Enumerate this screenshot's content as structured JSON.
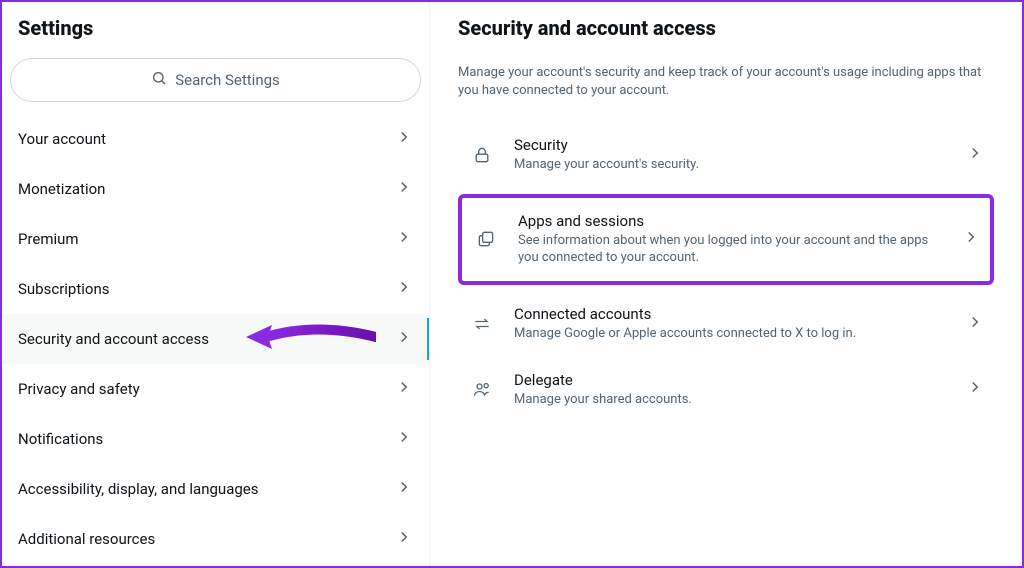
{
  "sidebar": {
    "title": "Settings",
    "search_placeholder": "Search Settings",
    "items": [
      {
        "label": "Your account"
      },
      {
        "label": "Monetization"
      },
      {
        "label": "Premium"
      },
      {
        "label": "Subscriptions"
      },
      {
        "label": "Security and account access"
      },
      {
        "label": "Privacy and safety"
      },
      {
        "label": "Notifications"
      },
      {
        "label": "Accessibility, display, and languages"
      },
      {
        "label": "Additional resources"
      }
    ]
  },
  "main": {
    "title": "Security and account access",
    "description": "Manage your account's security and keep track of your account's usage including apps that you have connected to your account.",
    "rows": [
      {
        "title": "Security",
        "desc": "Manage your account's security."
      },
      {
        "title": "Apps and sessions",
        "desc": "See information about when you logged into your account and the apps you connected to your account."
      },
      {
        "title": "Connected accounts",
        "desc": "Manage Google or Apple accounts connected to X to log in."
      },
      {
        "title": "Delegate",
        "desc": "Manage your shared accounts."
      }
    ]
  },
  "annotations": {
    "highlight_color": "#8a2be2"
  }
}
